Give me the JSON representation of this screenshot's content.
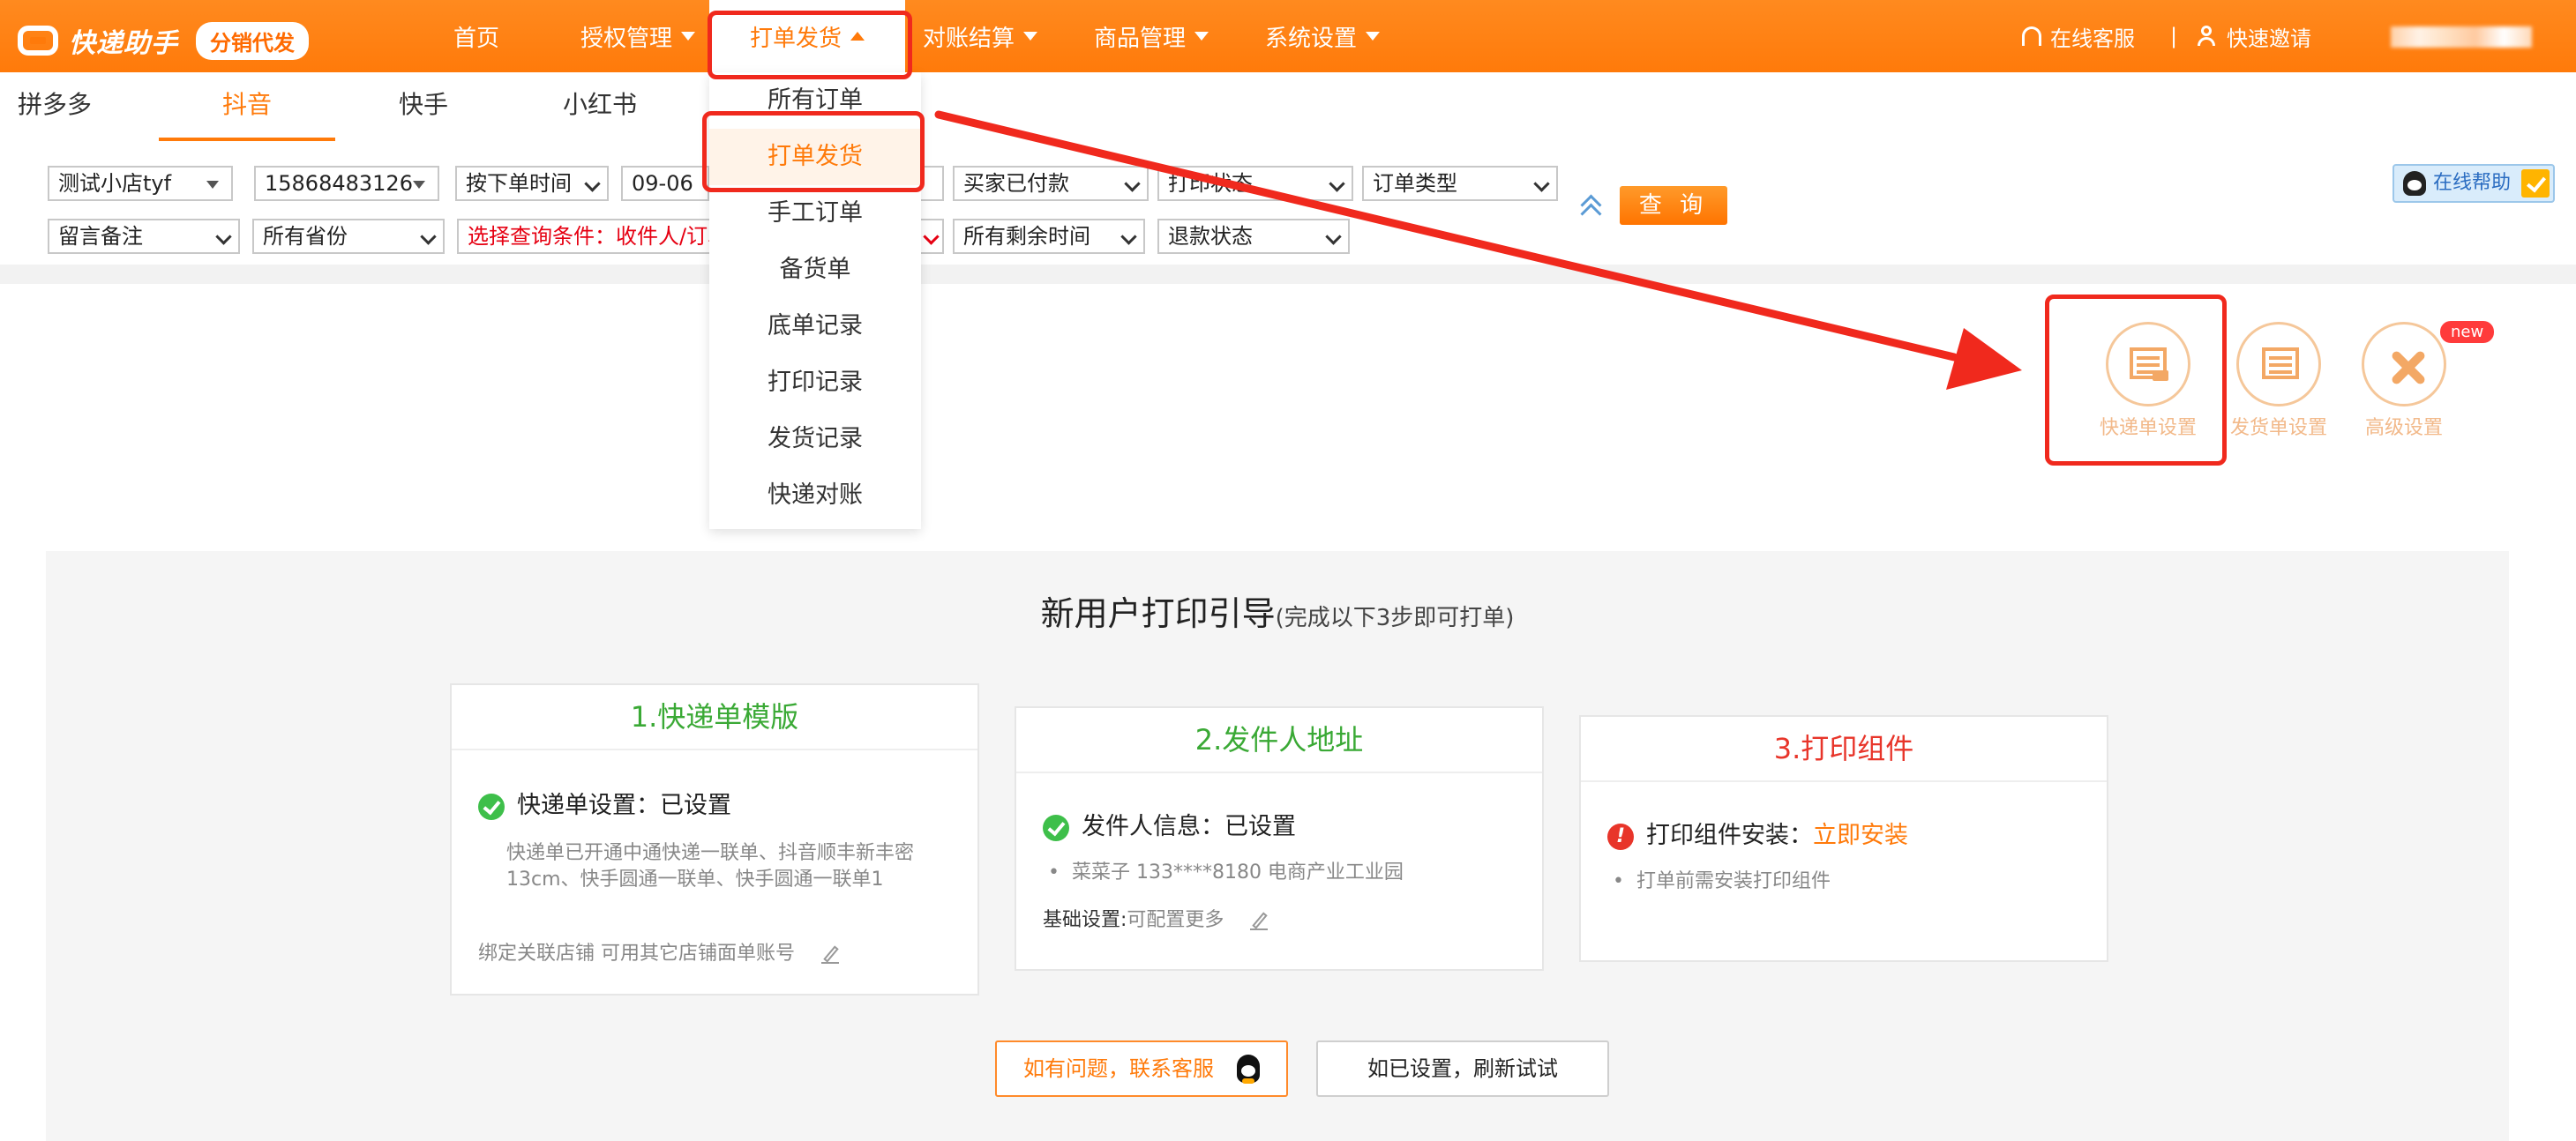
{
  "app": {
    "logo_text": "快递助手",
    "logo_badge": "分销代发"
  },
  "nav": {
    "items": [
      {
        "label": "首页"
      },
      {
        "label": "授权管理"
      },
      {
        "label": "打单发货"
      },
      {
        "label": "对账结算"
      },
      {
        "label": "商品管理"
      },
      {
        "label": "系统设置"
      }
    ],
    "support": "在线客服",
    "divider": "|",
    "invite": "快速邀请"
  },
  "platform_tabs": [
    {
      "label": "拼多多"
    },
    {
      "label": "抖音"
    },
    {
      "label": "快手"
    },
    {
      "label": "小红书"
    }
  ],
  "filters": {
    "shop": "测试小店tyf",
    "phone": "15868483126",
    "time_type": "按下单时间",
    "date": "09-06",
    "pay_status": "买家已付款",
    "print_status": "打印状态",
    "order_type": "订单类型",
    "remark": "留言备注",
    "province": "所有省份",
    "query_condition": "选择查询条件：收件人/订单",
    "remain_time": "所有剩余时间",
    "refund_status": "退款状态",
    "query_button": "查 询",
    "help_button": "在线帮助"
  },
  "dropdown": {
    "items": [
      {
        "label": "所有订单"
      },
      {
        "label": "打单发货"
      },
      {
        "label": "手工订单"
      },
      {
        "label": "备货单"
      },
      {
        "label": "底单记录"
      },
      {
        "label": "打印记录"
      },
      {
        "label": "发货记录"
      },
      {
        "label": "快递对账"
      }
    ]
  },
  "tools": {
    "express": "快递单设置",
    "ship": "发货单设置",
    "advanced": "高级设置",
    "new_badge": "new"
  },
  "guide": {
    "title": "新用户打印引导",
    "subtitle": "(完成以下3步即可打单)",
    "card1": {
      "title": "1.快递单模版",
      "status": "快递单设置：已设置",
      "detail": "快递单已开通中通快递一联单、抖音顺丰新丰密13cm、快手圆通一联单、快手圆通一联单1",
      "bind": "绑定关联店铺 可用其它店铺面单账号"
    },
    "card2": {
      "title": "2.发件人地址",
      "status": "发件人信息：已设置",
      "address": "菜菜子 133****8180 电商产业工业园",
      "basic_label": "基础设置:",
      "basic_value": "可配置更多"
    },
    "card3": {
      "title": "3.打印组件",
      "status_label": "打印组件安装：",
      "install": "立即安装",
      "note": "打单前需安装打印组件"
    },
    "contact_button": "如有问题，联系客服",
    "refresh_button": "如已设置，刷新试试"
  },
  "colors": {
    "brand": "#ff7a0a",
    "highlight": "#f0291d",
    "success": "#3aa935"
  }
}
